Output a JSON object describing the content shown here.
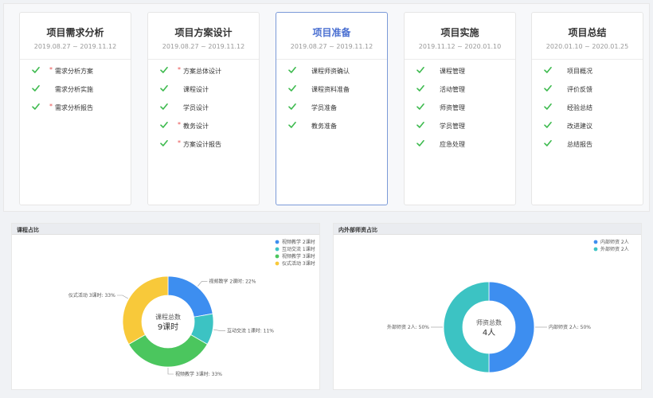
{
  "phases": [
    {
      "title": "项目需求分析",
      "date": "2019.08.27 ~ 2019.11.12",
      "active": false,
      "tasks": [
        {
          "label": "需求分析方案",
          "required": true
        },
        {
          "label": "需求分析实施",
          "required": false
        },
        {
          "label": "需求分析报告",
          "required": true
        }
      ]
    },
    {
      "title": "项目方案设计",
      "date": "2019.08.27 ~ 2019.11.12",
      "active": false,
      "tasks": [
        {
          "label": "方案总体设计",
          "required": true
        },
        {
          "label": "课程设计",
          "required": false
        },
        {
          "label": "学员设计",
          "required": false
        },
        {
          "label": "教务设计",
          "required": true
        },
        {
          "label": "方案设计报告",
          "required": true
        }
      ]
    },
    {
      "title": "项目准备",
      "date": "2019.08.27 ~ 2019.11.12",
      "active": true,
      "tasks": [
        {
          "label": "课程师资确认",
          "required": false
        },
        {
          "label": "课程资料准备",
          "required": false
        },
        {
          "label": "学员准备",
          "required": false
        },
        {
          "label": "教务准备",
          "required": false
        }
      ]
    },
    {
      "title": "项目实施",
      "date": "2019.11.12 ~ 2020.01.10",
      "active": false,
      "tasks": [
        {
          "label": "课程管理",
          "required": false
        },
        {
          "label": "活动管理",
          "required": false
        },
        {
          "label": "师资管理",
          "required": false
        },
        {
          "label": "学员管理",
          "required": false
        },
        {
          "label": "应急处理",
          "required": false
        }
      ]
    },
    {
      "title": "项目总结",
      "date": "2020.01.10 ~ 2020.01.25",
      "active": false,
      "tasks": [
        {
          "label": "项目概况",
          "required": false
        },
        {
          "label": "评价反馈",
          "required": false
        },
        {
          "label": "经验总结",
          "required": false
        },
        {
          "label": "改进建议",
          "required": false
        },
        {
          "label": "总结报告",
          "required": false
        }
      ]
    }
  ],
  "required_mark": "*",
  "colors": {
    "check": "#3dba4e",
    "required": "#e84d4d",
    "active_border": "#7b9ad8",
    "active_title": "#4a6fd1"
  },
  "icons": {
    "task_status": "check-icon"
  },
  "chart_data": [
    {
      "type": "pie",
      "title": "课程占比",
      "center_label": "课程总数",
      "center_value": "9课时",
      "series": [
        {
          "legend": "视频教学 2课时",
          "label": "视频教学 2课时: 22%",
          "value": 2,
          "color": "#3d8ef0"
        },
        {
          "legend": "互动交流 1课时",
          "label": "互动交流 1课时: 11%",
          "value": 1,
          "color": "#3cc3c3"
        },
        {
          "legend": "视频教学 3课时",
          "label": "视频教学 3课时: 33%",
          "value": 3,
          "color": "#4bc65e"
        },
        {
          "legend": "仪式活动 3课时",
          "label": "仪式活动 3课时: 33%",
          "value": 3,
          "color": "#f8c93a"
        }
      ]
    },
    {
      "type": "pie",
      "title": "内外部师资占比",
      "center_label": "师资总数",
      "center_value": "4人",
      "series": [
        {
          "legend": "内部师资 2人",
          "label": "内部师资 2人: 50%",
          "value": 2,
          "color": "#3d8ef0"
        },
        {
          "legend": "外部师资 2人",
          "label": "外部师资 2人: 50%",
          "value": 2,
          "color": "#3cc3c3"
        }
      ]
    }
  ]
}
